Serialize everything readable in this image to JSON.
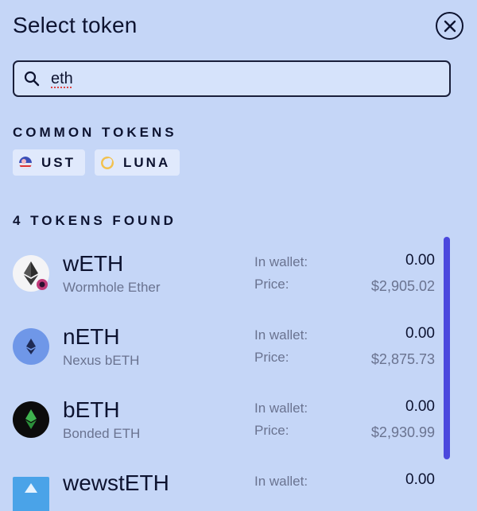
{
  "header": {
    "title": "Select token"
  },
  "search": {
    "value": "eth"
  },
  "common": {
    "label": "COMMON TOKENS",
    "chips": [
      {
        "label": "UST",
        "icon": "ust-icon"
      },
      {
        "label": "LUNA",
        "icon": "luna-icon"
      }
    ]
  },
  "results": {
    "label": "4 TOKENS FOUND",
    "wallet_label": "In wallet:",
    "price_label": "Price:",
    "tokens": [
      {
        "symbol": "wETH",
        "name": "Wormhole Ether",
        "wallet": "0.00",
        "price": "$2,905.02",
        "icon": "weth-icon"
      },
      {
        "symbol": "nETH",
        "name": "Nexus bETH",
        "wallet": "0.00",
        "price": "$2,875.73",
        "icon": "neth-icon"
      },
      {
        "symbol": "bETH",
        "name": "Bonded ETH",
        "wallet": "0.00",
        "price": "$2,930.99",
        "icon": "beth-icon"
      },
      {
        "symbol": "wewstETH",
        "name": "",
        "wallet": "0.00",
        "price": "",
        "icon": "wewsteth-icon"
      }
    ]
  },
  "colors": {
    "background": "#c5d6f7",
    "accent": "#4b48dd",
    "text": "#0d1330",
    "muted": "#6a7390"
  }
}
